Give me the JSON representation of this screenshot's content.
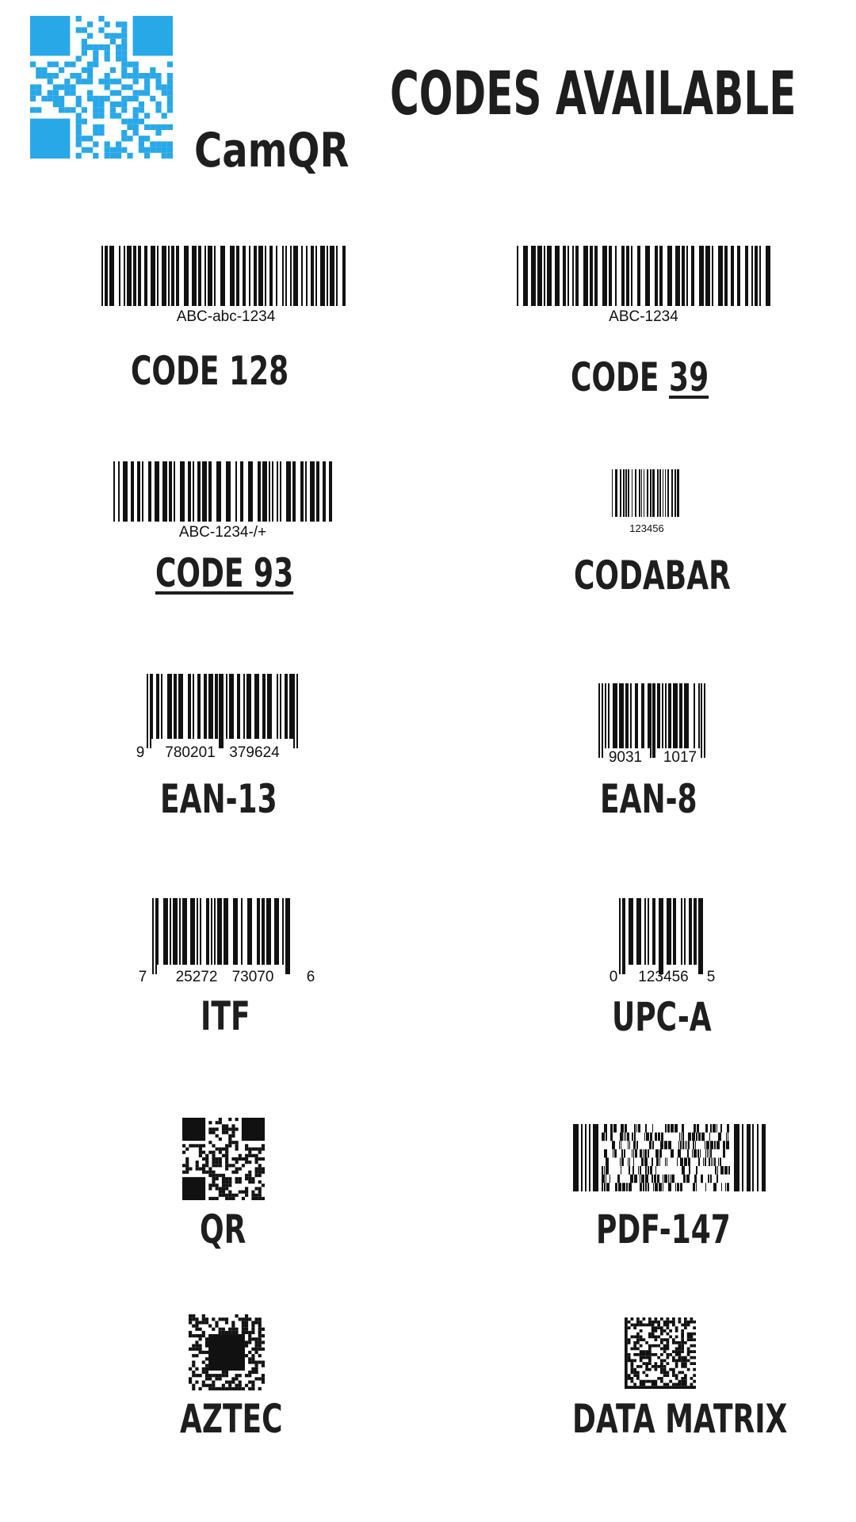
{
  "header": {
    "app_name": "CamQR",
    "title": "CODES AVAILABLE",
    "logo_icon": "qr-logo-icon",
    "logo_color": "#29a8e8"
  },
  "codes": [
    {
      "name": "CODE 128",
      "human_readable": "ABC-abc-1234"
    },
    {
      "name_prefix": "CODE ",
      "name_underlined": "39",
      "human_readable": "ABC-1234"
    },
    {
      "name": "CODE 93",
      "human_readable": "ABC-1234-/+"
    },
    {
      "name": "CODABAR",
      "human_readable": "123456"
    },
    {
      "name": "EAN-13",
      "digits": [
        "9",
        "780201",
        "379624"
      ]
    },
    {
      "name": "EAN-8",
      "digits": [
        "9031",
        "1017"
      ]
    },
    {
      "name": "ITF",
      "digits": [
        "7",
        "25272",
        "73070",
        "6"
      ]
    },
    {
      "name": "UPC-A",
      "digits": [
        "0",
        "123456",
        "5"
      ]
    },
    {
      "name": "QR"
    },
    {
      "name": "PDF-147"
    },
    {
      "name": "AZTEC"
    },
    {
      "name": "DATA MATRIX"
    }
  ],
  "colors": {
    "text": "#1e1e1e",
    "bars": "#111111",
    "background": "#ffffff"
  }
}
